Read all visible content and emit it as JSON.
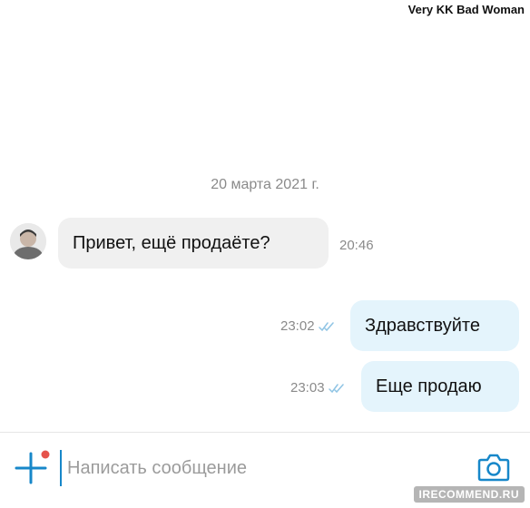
{
  "user_name": "Very KK Bad Woman",
  "date_separator": "20 марта 2021 г.",
  "messages": [
    {
      "direction": "incoming",
      "text": "Привет, ещё продаёте?",
      "time": "20:46"
    },
    {
      "direction": "outgoing",
      "text": "Здравствуйте",
      "time": "23:02",
      "read": true
    },
    {
      "direction": "outgoing",
      "text": "Еще продаю",
      "time": "23:03",
      "read": true
    }
  ],
  "composer": {
    "placeholder": "Написать сообщение",
    "value": ""
  },
  "icons": {
    "add": "plus-icon",
    "add_badge": "notification-dot",
    "camera": "camera-icon",
    "read": "double-check-icon"
  },
  "colors": {
    "accent": "#1787c9",
    "badge": "#e5534b",
    "incoming_bubble": "#f0f0f0",
    "outgoing_bubble": "#e4f4fc"
  },
  "watermark": "IRECOMMEND.RU"
}
